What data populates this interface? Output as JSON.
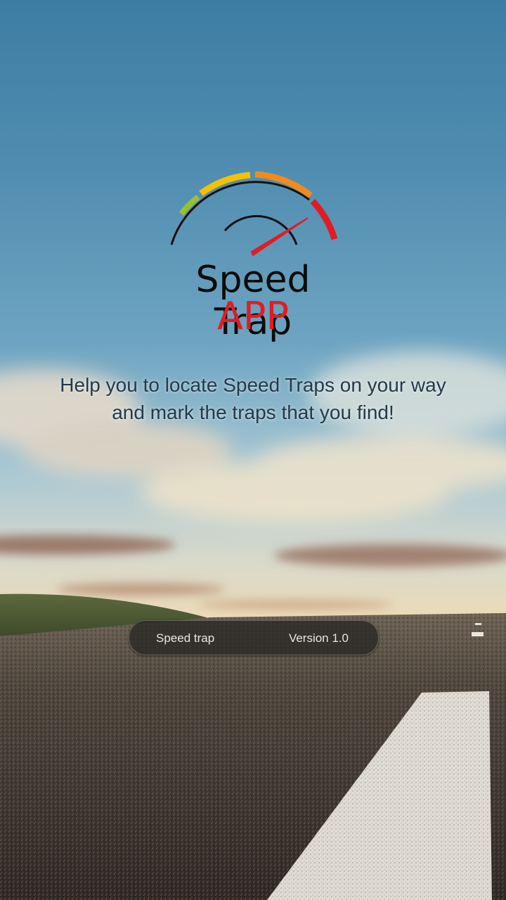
{
  "brand": {
    "name": "Speed Trap",
    "sub": "APP"
  },
  "tagline": "Help you to locate Speed Traps on your way and mark the traps that you find!",
  "footer": {
    "app_label": "Speed trap",
    "version_label": "Version 1.0"
  },
  "colors": {
    "gauge_green": "#9bc02f",
    "gauge_yellow": "#f5c100",
    "gauge_orange": "#f28a1c",
    "gauge_red": "#e11c24",
    "brand_sub": "#e11c24",
    "tagline": "#223a4a"
  }
}
